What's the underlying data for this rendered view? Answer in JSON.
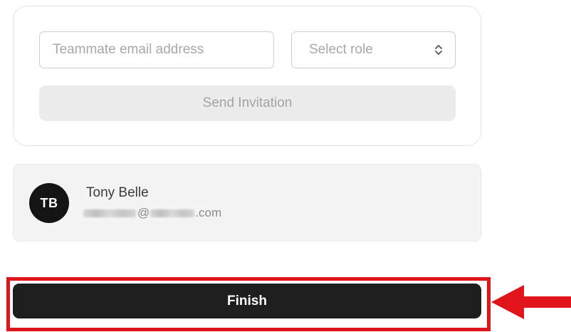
{
  "invite": {
    "email_placeholder": "Teammate email address",
    "role_placeholder": "Select role",
    "send_label": "Send Invitation"
  },
  "member": {
    "initials": "TB",
    "name": "Tony Belle",
    "email_at": "@",
    "email_tld": ".com"
  },
  "finish_label": "Finish",
  "icons": {
    "role_select": "chevron-up-down-icon",
    "annotation": "arrow-left-icon"
  },
  "colors": {
    "annotation_red": "#e0141b",
    "primary_button": "#1e1e1e",
    "avatar_bg": "#141414"
  }
}
